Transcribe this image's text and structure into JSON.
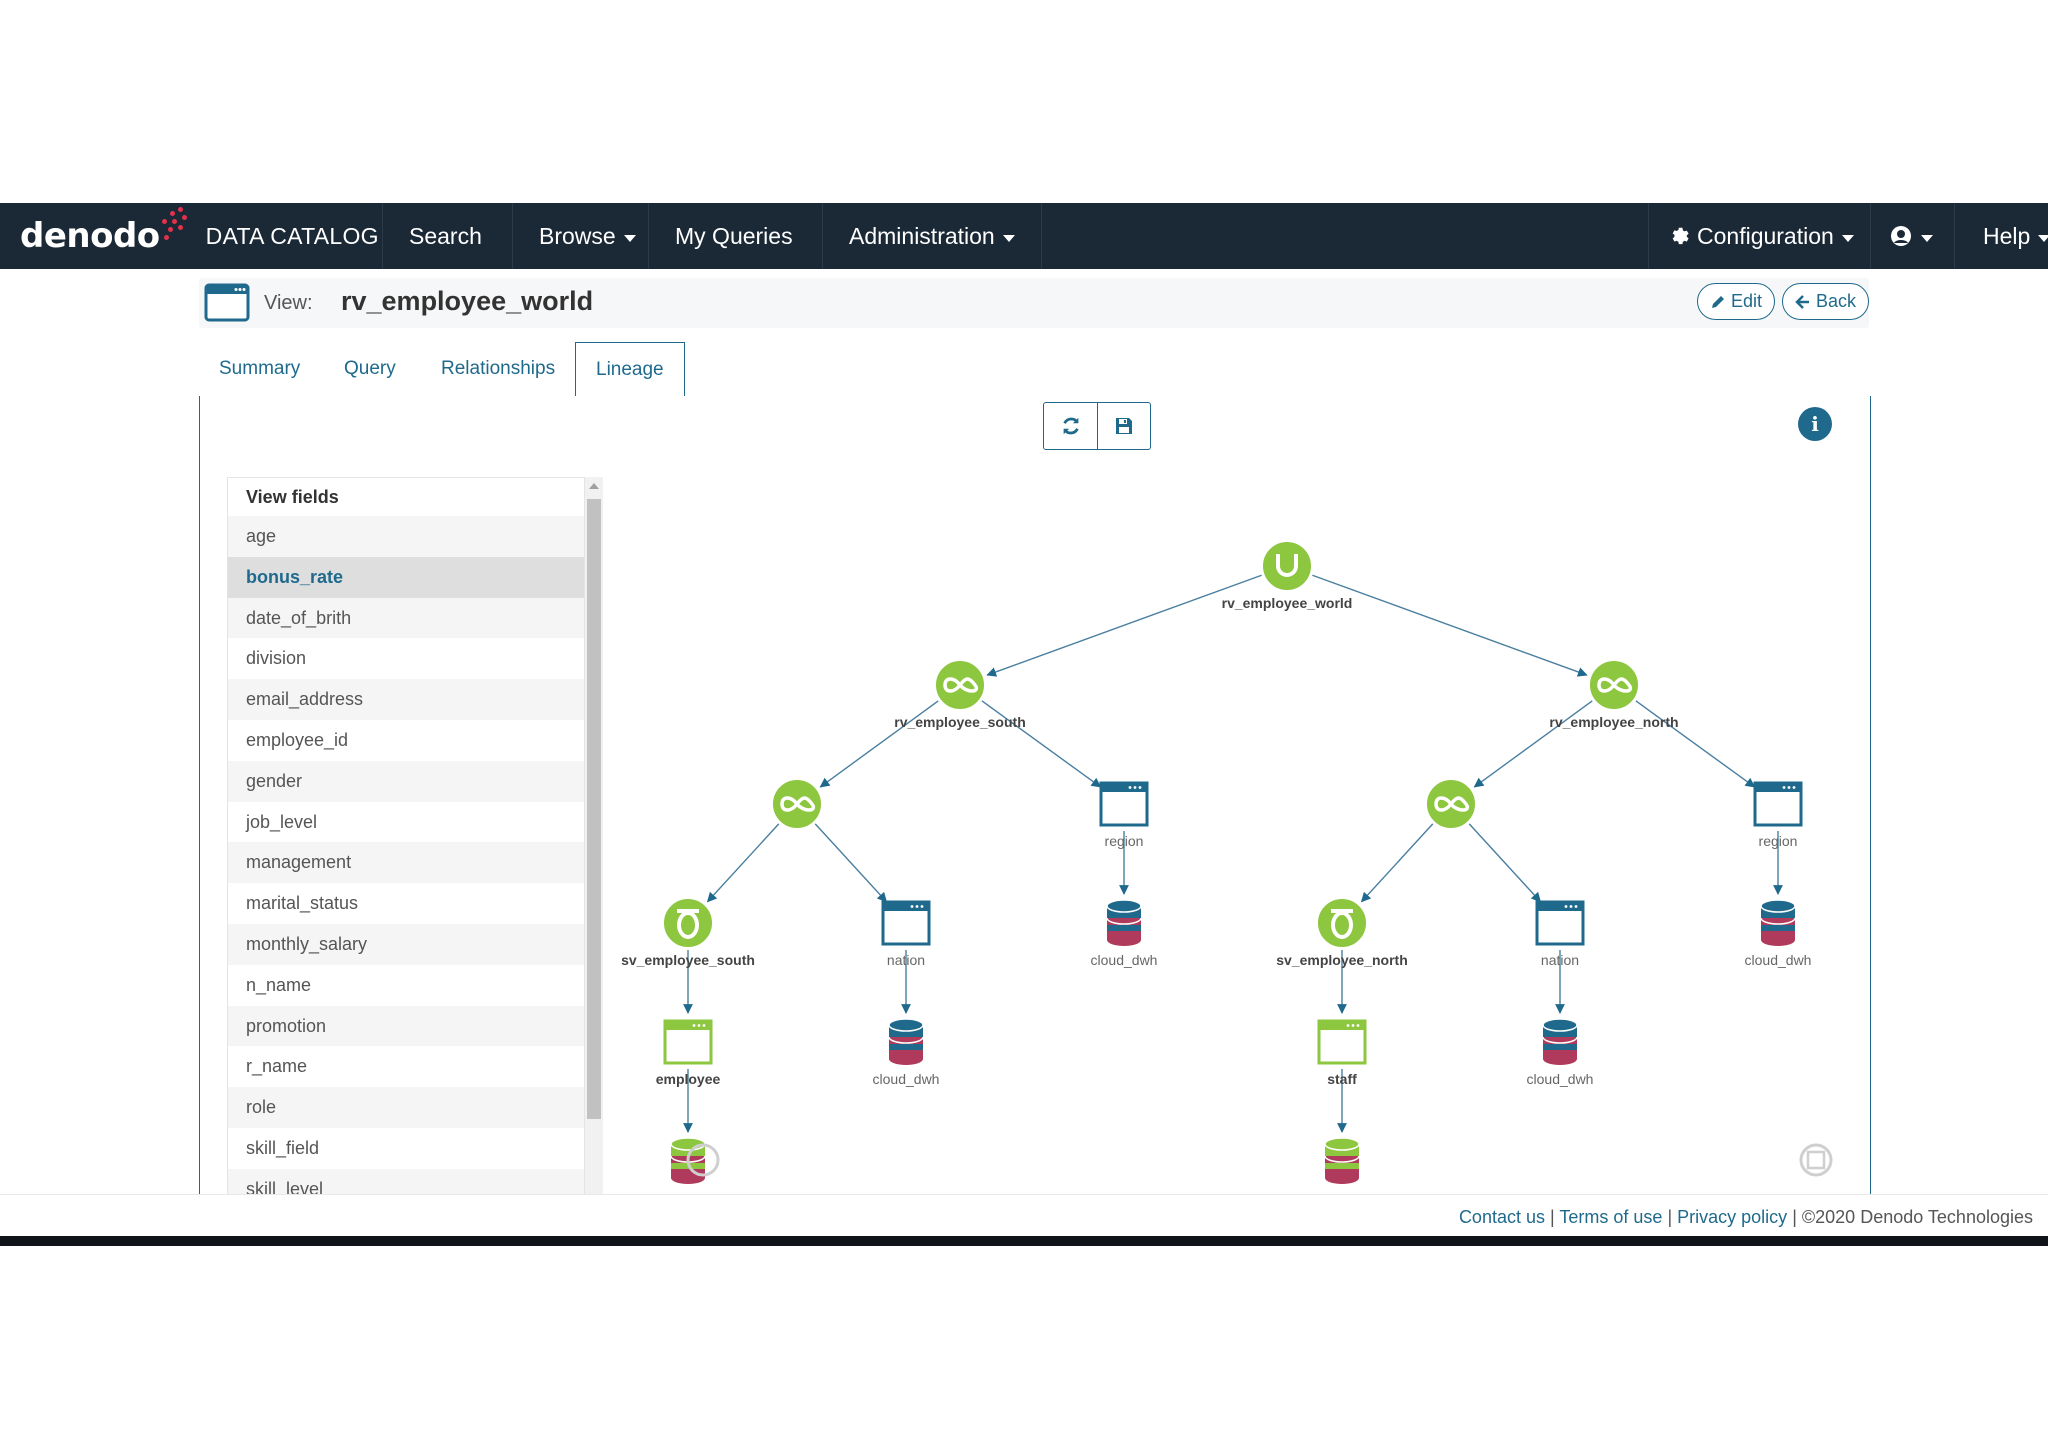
{
  "nav": {
    "brand": "denodo",
    "product": "DATA CATALOG",
    "search": "Search",
    "browse": "Browse",
    "my_queries": "My Queries",
    "administration": "Administration",
    "configuration": "Configuration",
    "help": "Help",
    "icons": {
      "configuration": "gear-icon",
      "user": "user-circle-icon"
    }
  },
  "view": {
    "label": "View:",
    "name": "rv_employee_world",
    "edit": "Edit",
    "back": "Back"
  },
  "tabs": [
    "Summary",
    "Query",
    "Relationships",
    "Lineage"
  ],
  "active_tab": "Lineage",
  "toolbar": {
    "refresh_icon": "refresh-icon",
    "save_icon": "save-icon",
    "info_icon": "info-icon"
  },
  "fields_panel": {
    "title": "View fields",
    "selected": "bonus_rate",
    "fields": [
      "age",
      "bonus_rate",
      "date_of_brith",
      "division",
      "email_address",
      "employee_id",
      "gender",
      "job_level",
      "management",
      "marital_status",
      "monthly_salary",
      "n_name",
      "promotion",
      "r_name",
      "role",
      "skill_field",
      "skill_level"
    ]
  },
  "lineage": {
    "nodes": [
      {
        "id": "root",
        "label": "rv_employee_world",
        "type": "union"
      },
      {
        "id": "south",
        "label": "rv_employee_south",
        "type": "join"
      },
      {
        "id": "north",
        "label": "rv_employee_north",
        "type": "join"
      },
      {
        "id": "s_join",
        "label": "",
        "type": "join"
      },
      {
        "id": "s_region",
        "label": "region",
        "type": "view"
      },
      {
        "id": "n_join",
        "label": "",
        "type": "join"
      },
      {
        "id": "n_region",
        "label": "region",
        "type": "view"
      },
      {
        "id": "sv_south",
        "label": "sv_employee_south",
        "type": "selection"
      },
      {
        "id": "s_nation",
        "label": "nation",
        "type": "view"
      },
      {
        "id": "s_region_db",
        "label": "cloud_dwh",
        "type": "datasource"
      },
      {
        "id": "sv_north",
        "label": "sv_employee_north",
        "type": "selection"
      },
      {
        "id": "n_nation",
        "label": "nation",
        "type": "view"
      },
      {
        "id": "n_region_db",
        "label": "cloud_dwh",
        "type": "datasource"
      },
      {
        "id": "employee",
        "label": "employee",
        "type": "base-view"
      },
      {
        "id": "s_nation_db",
        "label": "cloud_dwh",
        "type": "datasource"
      },
      {
        "id": "staff",
        "label": "staff",
        "type": "base-view"
      },
      {
        "id": "n_nation_db",
        "label": "cloud_dwh",
        "type": "datasource"
      },
      {
        "id": "employee_db",
        "label": "",
        "type": "datasource"
      },
      {
        "id": "staff_db",
        "label": "",
        "type": "datasource"
      }
    ],
    "edges": [
      [
        "root",
        "south"
      ],
      [
        "root",
        "north"
      ],
      [
        "south",
        "s_join"
      ],
      [
        "south",
        "s_region"
      ],
      [
        "north",
        "n_join"
      ],
      [
        "north",
        "n_region"
      ],
      [
        "s_join",
        "sv_south"
      ],
      [
        "s_join",
        "s_nation"
      ],
      [
        "s_region",
        "s_region_db"
      ],
      [
        "n_join",
        "sv_north"
      ],
      [
        "n_join",
        "n_nation"
      ],
      [
        "n_region",
        "n_region_db"
      ],
      [
        "sv_south",
        "employee"
      ],
      [
        "s_nation",
        "s_nation_db"
      ],
      [
        "sv_north",
        "staff"
      ],
      [
        "n_nation",
        "n_nation_db"
      ],
      [
        "employee",
        "employee_db"
      ],
      [
        "staff",
        "staff_db"
      ]
    ],
    "colors": {
      "green": "#8dc63f",
      "blue": "#1f6a8c",
      "edge": "#4a7fa0",
      "db_red": "#b03a5b"
    }
  },
  "footer": {
    "contact": "Contact us",
    "terms": "Terms of use",
    "privacy": "Privacy policy",
    "copyright": "©2020 Denodo Technologies",
    "separator": "|"
  }
}
